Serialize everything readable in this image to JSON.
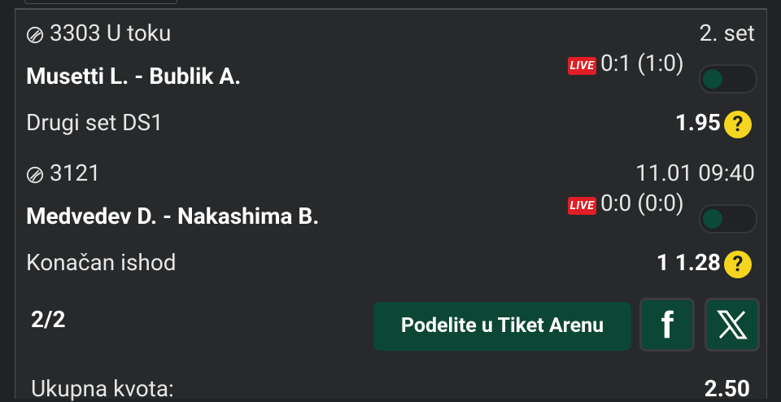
{
  "bets": [
    {
      "event_code": "3303 U toku",
      "time_status": "2. set",
      "match": "Musetti L. - Bublik A.",
      "live_label": "LIVE",
      "score": "0:1 (1:0)",
      "market": "Drugi set DS1",
      "odds": "1.95",
      "help": "?"
    },
    {
      "event_code": "3121",
      "time_status": "11.01 09:40",
      "match": "Medvedev D. - Nakashima B.",
      "live_label": "LIVE",
      "score": "0:0 (0:0)",
      "market": "Konačan ishod",
      "odds": "1 1.28",
      "help": "?"
    }
  ],
  "footer": {
    "count": "2/2",
    "share_label": "Podelite u Tiket Arenu",
    "facebook_label": "f",
    "x_icon": "x-logo-icon",
    "total_label": "Ukupna kvota:",
    "total_value": "2.50"
  },
  "colors": {
    "background": "#202224",
    "panel": "#27292b",
    "accent_green": "#0c4634",
    "live_red": "#e01e24",
    "help_yellow": "#f5d51f"
  }
}
